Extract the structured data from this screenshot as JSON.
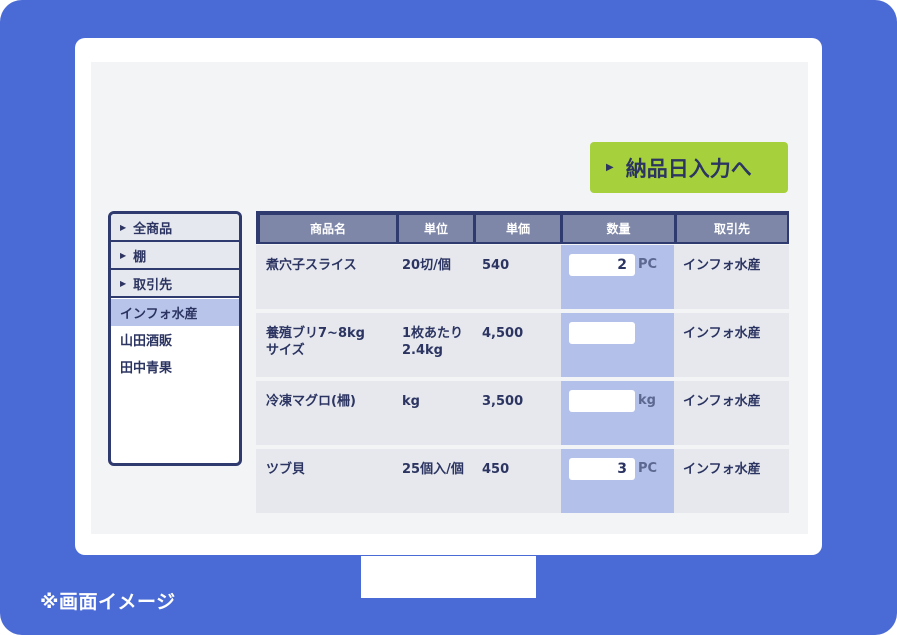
{
  "cta": {
    "label": "納品日入力へ"
  },
  "sidebar": {
    "categories": [
      {
        "label": "全商品"
      },
      {
        "label": "棚"
      },
      {
        "label": "取引先"
      }
    ],
    "items": [
      {
        "label": "インフォ水産",
        "selected": true
      },
      {
        "label": "山田酒販",
        "selected": false
      },
      {
        "label": "田中青果",
        "selected": false
      }
    ]
  },
  "table": {
    "headers": [
      "商品名",
      "単位",
      "単価",
      "数量",
      "取引先"
    ],
    "rows": [
      {
        "name": "煮穴子スライス",
        "unit": "20切/個",
        "price": "540",
        "qty": "2",
        "qty_unit": "PC",
        "supplier": "インフォ水産"
      },
      {
        "name": "養殖ブリ7~8kg",
        "name2": "サイズ",
        "unit": "1枚あたり",
        "unit2": "2.4kg",
        "price": "4,500",
        "qty": "",
        "qty_unit": "",
        "supplier": "インフォ水産"
      },
      {
        "name": "冷凍マグロ(柵)",
        "unit": "kg",
        "price": "3,500",
        "qty": "",
        "qty_unit": "kg",
        "supplier": "インフォ水産"
      },
      {
        "name": "ツブ貝",
        "unit": "25個入/個",
        "price": "450",
        "qty": "3",
        "qty_unit": "PC",
        "supplier": "インフォ水産"
      }
    ]
  },
  "caption": "※画面イメージ",
  "colors": {
    "frame": "#4a6bd6",
    "accent": "#a6d13c",
    "navy": "#2f3a6e",
    "quantity_column": "#b3c0ea",
    "selected_item": "#b9c4ea"
  }
}
